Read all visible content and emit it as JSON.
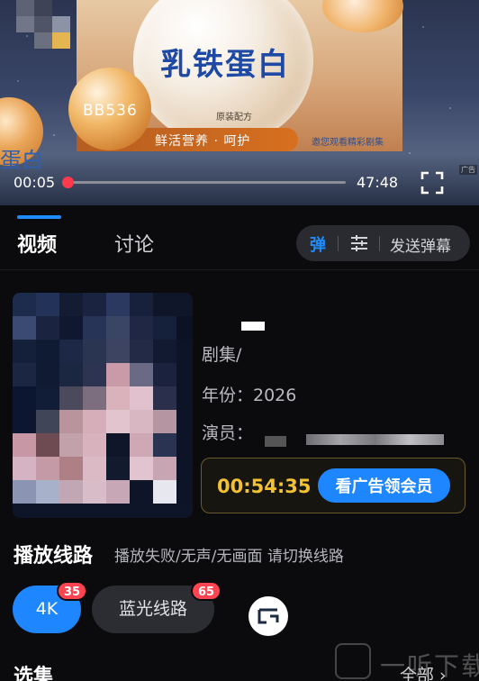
{
  "video": {
    "ad_title": "乳铁蛋白",
    "ad_code": "BB536",
    "ad_sub_text": "原装配方",
    "ad_pill_text": "鲜活营养 · 呵护",
    "ad_right_text": "邀您观看精彩剧集",
    "edge_text": "蛋白",
    "corner_label": "广告",
    "current_time": "00:05",
    "total_time": "47:48",
    "progress_fraction": 0.01
  },
  "tabs": [
    {
      "label": "视频"
    },
    {
      "label": "讨论"
    }
  ],
  "danmaku": {
    "toggle_label": "弹",
    "send_label": "发送弹幕"
  },
  "info": {
    "genre_label": "剧集/",
    "year_line": "年份：2026",
    "cast_label": "演员："
  },
  "member": {
    "countdown": "00:54:35",
    "button_label": "看广告领会员"
  },
  "lines": {
    "title": "播放线路",
    "hint": "播放失败/无声/无画面 请切换线路",
    "items": [
      {
        "label": "4K",
        "badge": "35"
      },
      {
        "label": "蓝光线路",
        "badge": "65"
      }
    ]
  },
  "episodes": {
    "title": "选集",
    "all_label": "全部 ›"
  },
  "watermark": {
    "text": "一听下载"
  },
  "colors": {
    "accent": "#1e86ff",
    "progress": "#ff3a4e",
    "countdown": "#f2c233",
    "badge": "#ff4451"
  }
}
